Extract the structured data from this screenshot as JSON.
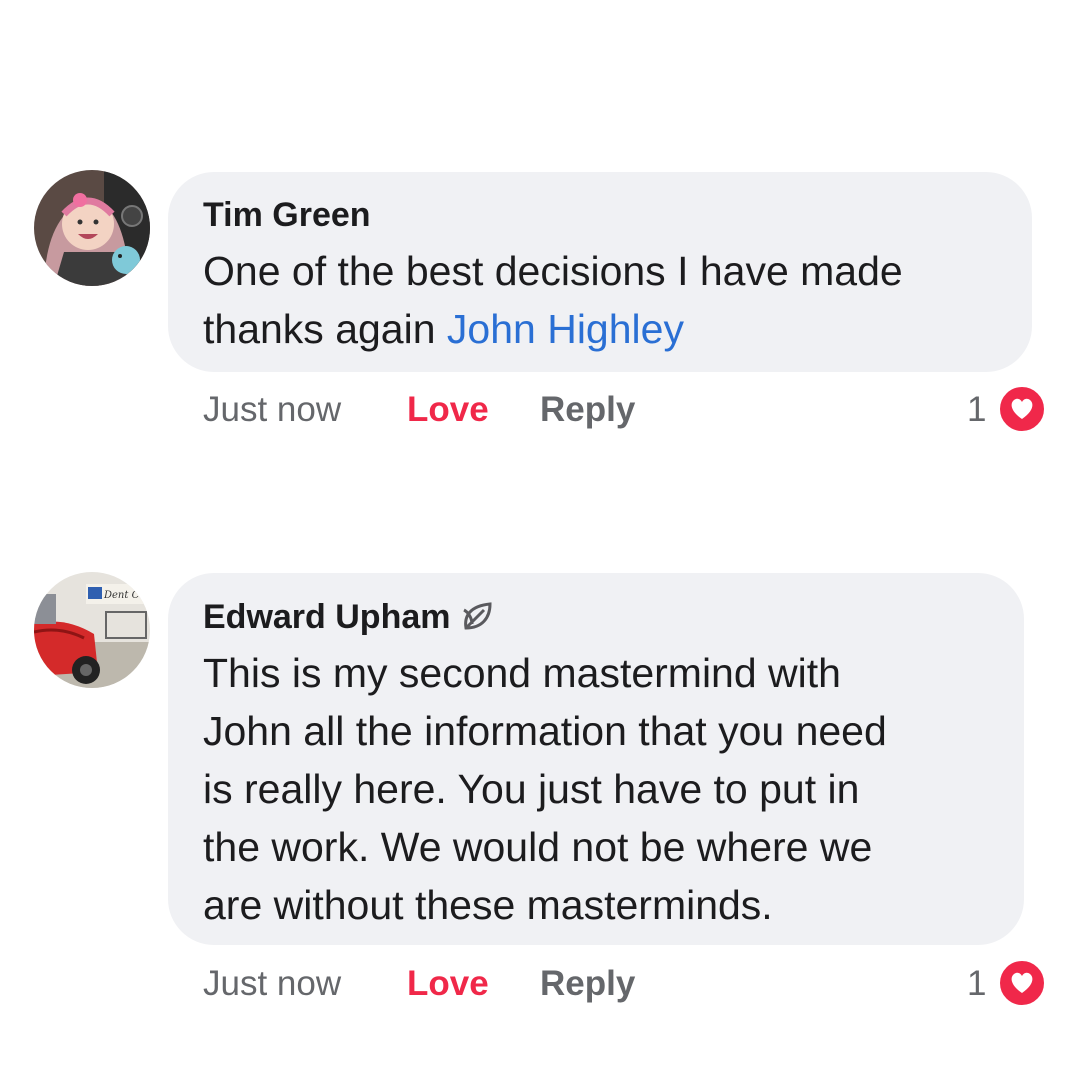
{
  "comments": [
    {
      "author": "Tim Green",
      "text_lines": [
        "One of the best decisions I have made",
        "thanks again "
      ],
      "mention": "John Highley",
      "time": "Just now",
      "love_label": "Love",
      "reply_label": "Reply",
      "reaction_count": "1",
      "reaction_icon": "heart-icon",
      "avatar_icon": "baby-avatar"
    },
    {
      "author": "Edward Upham",
      "author_badge_icon": "leaf-icon",
      "text_lines": [
        "This is my second mastermind with",
        "John all the information that you need",
        "is really here. You just have to put in",
        "the work. We would not be where we",
        "are without these masterminds."
      ],
      "time": "Just now",
      "love_label": "Love",
      "reply_label": "Reply",
      "reaction_count": "1",
      "reaction_icon": "heart-icon",
      "avatar_icon": "car-shop-avatar",
      "avatar_sign_text": "Dent Co"
    }
  ],
  "colors": {
    "bubble": "#f0f1f4",
    "love": "#f02849",
    "mention": "#2a6fd4",
    "meta": "#65676b"
  }
}
